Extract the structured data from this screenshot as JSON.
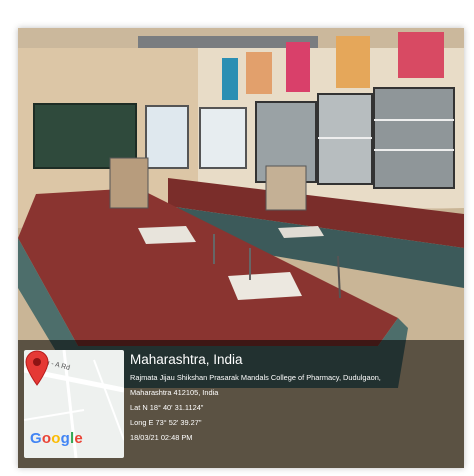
{
  "photo": {
    "description_icon": "laboratory-photo"
  },
  "geotag": {
    "title": "Maharashtra, India",
    "address_line1": "Rajmata Jijau Shikshan Prasarak Mandals College of Pharmacy, Dudulgaon,",
    "address_line2": "Maharashtra 412105, India",
    "latitude": "Lat N 18° 40' 31.1124\"",
    "longitude": "Long E 73° 52' 39.27\"",
    "datetime": "18/03/21 02:48 PM"
  },
  "map": {
    "road_label": "Dehu - A        Rd",
    "provider": "Google",
    "pin_color": "#e53935",
    "google_colors": [
      "#4285f4",
      "#ea4335",
      "#fbbc05",
      "#4285f4",
      "#34a853",
      "#ea4335"
    ]
  }
}
